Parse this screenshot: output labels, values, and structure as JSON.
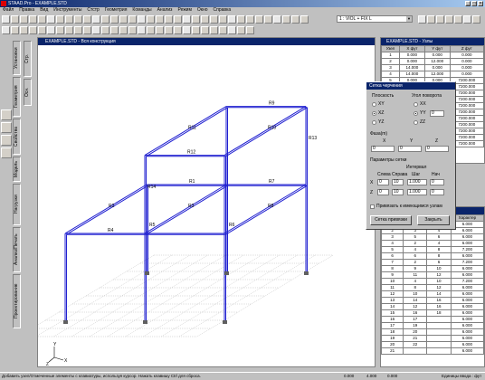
{
  "window": {
    "title": "STAAD.Pro - EXAMPLE.STD"
  },
  "menu": [
    "Файл",
    "Правка",
    "Вид",
    "Инструменты",
    "Cтстр",
    "Геометрия",
    "Команды",
    "Анализ",
    "Режим",
    "Окно",
    "Справка"
  ],
  "combo": {
    "value": "1 : VIOL + FIX L"
  },
  "left_tabs": [
    "Установки",
    "Геометрия",
    "Свойства",
    "Модель",
    "Нагрузки",
    "Анализ/Печать",
    "Проектирование"
  ],
  "viewport": {
    "title": "EXAMPLE.STD - Вся конструкция",
    "axis_label": "Y",
    "axis_x": "X",
    "axis_z": "Z"
  },
  "node_table": {
    "title": "EXAMPLE.STD - Узлы",
    "headers": [
      "Узел",
      "X\nфут",
      "Y\nфут",
      "Z\nфут"
    ],
    "rows": [
      [
        "1",
        "0.000",
        "0.000",
        "0.000"
      ],
      [
        "2",
        "0.000",
        "12.000",
        "0.000"
      ],
      [
        "3",
        "14.000",
        "0.000",
        "0.000"
      ],
      [
        "4",
        "14.000",
        "12.000",
        "0.000"
      ],
      [
        "5",
        "0.000",
        "0.000",
        "7200.000"
      ],
      [
        "6",
        "0.000",
        "12.000",
        "7200.000"
      ],
      [
        "7",
        "",
        "",
        "7200.000"
      ],
      [
        "8",
        "",
        "",
        "7200.000"
      ],
      [
        "9",
        "",
        "",
        "7200.000"
      ],
      [
        "10",
        "",
        "",
        "7200.000"
      ],
      [
        "11",
        "",
        "",
        "7200.000"
      ],
      [
        "12",
        "",
        "",
        "7200.000"
      ],
      [
        "13",
        "",
        "",
        "7200.000"
      ],
      [
        "14",
        "",
        "",
        "7200.000"
      ],
      [
        "15",
        "",
        "",
        "7200.000"
      ]
    ]
  },
  "beam_table": {
    "title": "EXAMPLE.STD - Балки",
    "headers": [
      "Балка",
      "Узел A",
      "Узел B",
      "Характер"
    ],
    "rows": [
      [
        "1",
        "1",
        "2",
        "6.000"
      ],
      [
        "2",
        "3",
        "4",
        "6.000"
      ],
      [
        "3",
        "5",
        "6",
        "6.000"
      ],
      [
        "4",
        "2",
        "4",
        "6.000"
      ],
      [
        "5",
        "4",
        "8",
        "7.200"
      ],
      [
        "6",
        "6",
        "8",
        "6.000"
      ],
      [
        "7",
        "2",
        "6",
        "7.200"
      ],
      [
        "8",
        "9",
        "10",
        "6.000"
      ],
      [
        "9",
        "11",
        "12",
        "6.000"
      ],
      [
        "10",
        "4",
        "10",
        "7.200"
      ],
      [
        "11",
        "8",
        "12",
        "6.000"
      ],
      [
        "12",
        "10",
        "14",
        "6.000"
      ],
      [
        "13",
        "14",
        "16",
        "6.000"
      ],
      [
        "14",
        "12",
        "16",
        "6.000"
      ],
      [
        "15",
        "16",
        "18",
        "6.000"
      ],
      [
        "16",
        "17",
        "",
        "6.000"
      ],
      [
        "17",
        "19",
        "",
        "6.000"
      ],
      [
        "18",
        "20",
        "",
        "6.000"
      ],
      [
        "19",
        "21",
        "",
        "6.000"
      ],
      [
        "20",
        "22",
        "",
        "6.000"
      ],
      [
        "21",
        "",
        "",
        "6.000"
      ]
    ]
  },
  "dialog": {
    "title": "Сетка черчения",
    "plane_label": "Плоскость",
    "planes": [
      "XY",
      "XZ",
      "YZ"
    ],
    "selected_plane": "XZ",
    "angle_label": "Угол поворота",
    "angles": [
      "XX",
      "YY",
      "ZZ"
    ],
    "selected_angle": "YY",
    "angle_value": "0",
    "origin_label": "Фаза(m)",
    "origin_cols": [
      "X",
      "Y",
      "Z"
    ],
    "origin_values": [
      "0",
      "0",
      "0"
    ],
    "grid_params_label": "Параметры сетки",
    "interval_label": "Интервал",
    "col_headers": [
      "Слева",
      "Справа",
      "Шаг",
      "Нач"
    ],
    "row_x": {
      "axis": "X",
      "left": "0",
      "right": "10",
      "step": "1.000",
      "start": "0"
    },
    "row_z": {
      "axis": "Z",
      "left": "0",
      "right": "10",
      "step": "1.000",
      "start": "0"
    },
    "snap_label": "Привязать к имеющимся узлам",
    "ok_button": "Сетка привязки",
    "close_button": "Закрыть"
  },
  "status": {
    "message": "Добавить узел/Отмеченные элементы с клавиатуры, используя курсор. Нажать клавишу Ctrl для сброса.",
    "coords": [
      "0.000",
      "4.000",
      "0.000"
    ],
    "units": "Единицы ввода : фут"
  },
  "beam_labels": [
    "R1",
    "R2",
    "R3",
    "R4",
    "R5",
    "R6",
    "R7",
    "R8",
    "R9",
    "R10",
    "R11",
    "R12",
    "R13",
    "R14"
  ]
}
